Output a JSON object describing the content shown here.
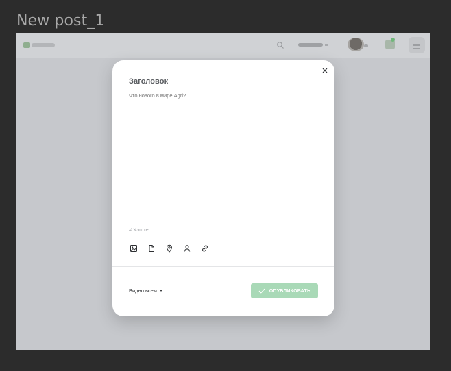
{
  "frame": {
    "title": "New post_1"
  },
  "topbar": {
    "logo_icon": "app-logo",
    "search_icon": "search-icon",
    "user_name_redacted": true,
    "avatar_icon": "avatar",
    "notifications_icon": "bell-icon",
    "menu_icon": "hamburger-icon"
  },
  "modal": {
    "title": "Заголовок",
    "body_placeholder": "Что нового в мире Agri?",
    "hashtag_placeholder": "# Хэштег",
    "attachments": [
      {
        "name": "image-icon"
      },
      {
        "name": "file-icon"
      },
      {
        "name": "location-icon"
      },
      {
        "name": "person-icon"
      },
      {
        "name": "link-icon"
      }
    ],
    "visibility_label": "Видно всем",
    "publish_label": "ОПУБЛИКОВАТЬ",
    "publish_enabled": false
  },
  "colors": {
    "page_background": "#2c2c2c",
    "overlay": "#c6c8cc",
    "modal_background": "#ffffff",
    "publish_button": "#a9d9b7",
    "accent_green": "#6fb77a"
  }
}
